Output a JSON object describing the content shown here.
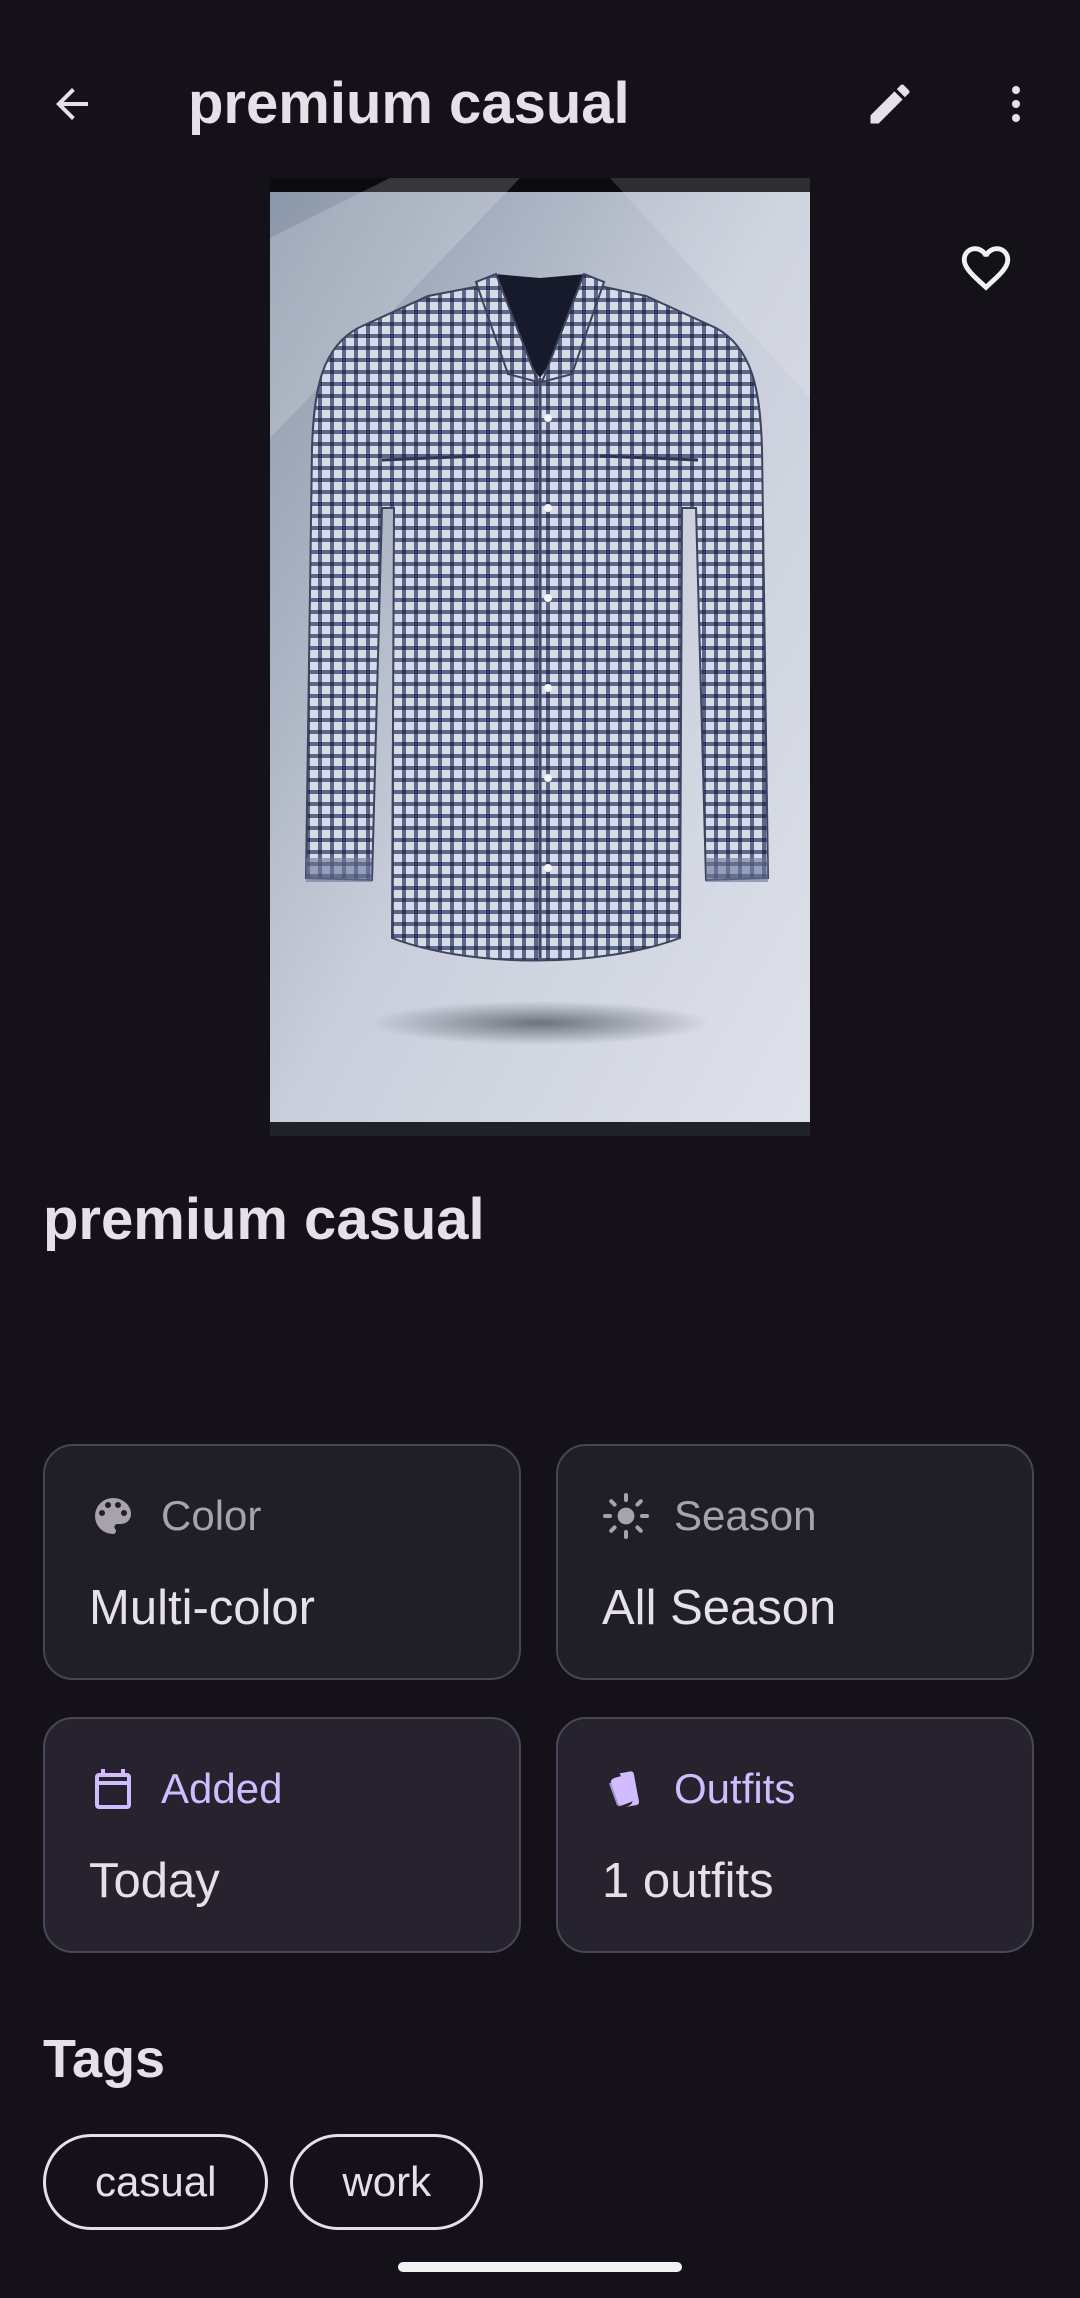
{
  "app_bar": {
    "title": "premium casual",
    "back_icon": "arrow-back-icon",
    "edit_icon": "pencil-icon",
    "more_icon": "more-vert-icon"
  },
  "photo": {
    "subject": "checked long-sleeve shirt",
    "favorite_icon": "heart-outline-icon"
  },
  "item": {
    "name": "premium casual"
  },
  "details": {
    "color": {
      "icon": "palette-icon",
      "label": "Color",
      "value": "Multi-color"
    },
    "season": {
      "icon": "sun-icon",
      "label": "Season",
      "value": "All Season"
    },
    "added": {
      "icon": "calendar-icon",
      "label": "Added",
      "value": "Today"
    },
    "outfits": {
      "icon": "tag-style-icon",
      "label": "Outfits",
      "value": "1 outfits"
    }
  },
  "tags": {
    "heading": "Tags",
    "items": [
      "casual",
      "work"
    ]
  },
  "colors": {
    "background": "#141218",
    "on_surface": "#e6e0e9",
    "muted_label": "#a7a2ad",
    "accent": "#d0bcff",
    "card_outline": "#49454f"
  }
}
